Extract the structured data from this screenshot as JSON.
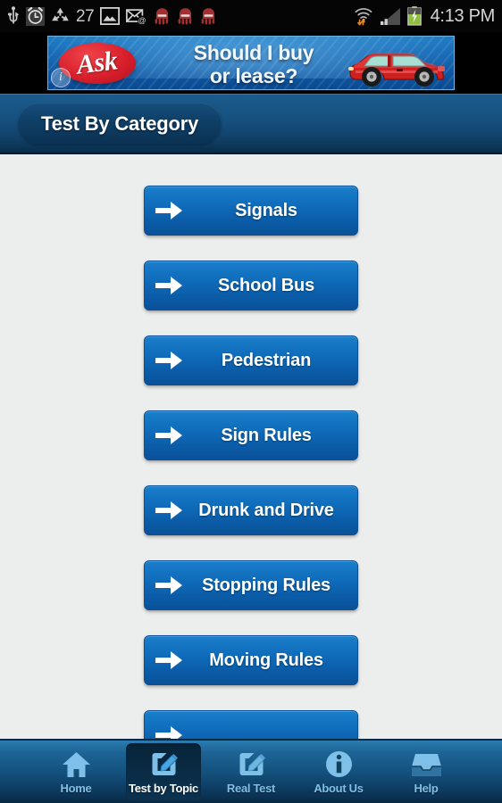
{
  "status_bar": {
    "icons": [
      {
        "name": "usb-icon",
        "glyph": "usb"
      },
      {
        "name": "alarm-clock-icon",
        "glyph": "alarm"
      },
      {
        "name": "sync-recycle-icon",
        "glyph": "recycle"
      },
      {
        "name": "notification-count",
        "glyph": "text",
        "value": "27"
      },
      {
        "name": "gallery-image-icon",
        "glyph": "image"
      },
      {
        "name": "email-icon",
        "glyph": "email"
      },
      {
        "name": "octopus-notification-icon-1",
        "glyph": "octopus"
      },
      {
        "name": "octopus-notification-icon-2",
        "glyph": "octopus"
      },
      {
        "name": "octopus-notification-icon-3",
        "glyph": "octopus"
      }
    ],
    "notification_count": "27",
    "wifi_icon": "wifi-transfer-icon",
    "signal_icon": "cellular-signal-icon",
    "battery_icon": "battery-charging-icon",
    "time": "4:13 PM"
  },
  "ad": {
    "brand": "Ask",
    "headline_line1": "Should I buy",
    "headline_line2": "or lease?",
    "info_label": "i",
    "image": "red-car-illustration"
  },
  "header": {
    "title": "Test By Category"
  },
  "categories": [
    {
      "label": "Signals"
    },
    {
      "label": "School Bus"
    },
    {
      "label": "Pedestrian"
    },
    {
      "label": "Sign Rules"
    },
    {
      "label": "Drunk and Drive"
    },
    {
      "label": "Stopping Rules"
    },
    {
      "label": "Moving Rules"
    },
    {
      "label": ""
    }
  ],
  "bottom_nav": [
    {
      "label": "Home",
      "icon": "home-icon",
      "selected": false
    },
    {
      "label": "Test by Topic",
      "icon": "edit-note-icon",
      "selected": true
    },
    {
      "label": "Real Test",
      "icon": "edit-note-icon",
      "selected": false
    },
    {
      "label": "About Us",
      "icon": "info-circle-icon",
      "selected": false
    },
    {
      "label": "Help",
      "icon": "inbox-tray-icon",
      "selected": false
    }
  ],
  "colors": {
    "button_blue_top": "#1a7ecb",
    "button_blue_bottom": "#0a5199",
    "header_blue_top": "#1b5c8e",
    "header_blue_bottom": "#0a2d49",
    "nav_icon_blue": "#7fc0e8",
    "content_bg": "#eceded",
    "ad_red": "#d8202c"
  }
}
